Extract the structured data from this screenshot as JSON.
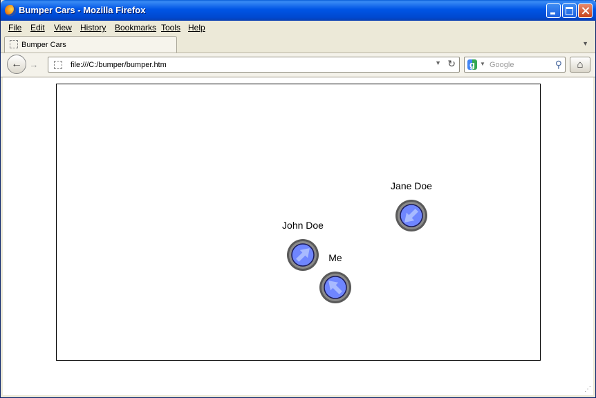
{
  "window": {
    "title": "Bumper Cars - Mozilla Firefox"
  },
  "menu": [
    "File",
    "Edit",
    "View",
    "History",
    "Bookmarks",
    "Tools",
    "Help"
  ],
  "tab": {
    "label": "Bumper Cars"
  },
  "navigation": {
    "url": "file:///C:/bumper/bumper.htm",
    "search_placeholder": "Google"
  },
  "cars": [
    {
      "name": "Jane Doe",
      "direction": "down-left"
    },
    {
      "name": "John Doe",
      "direction": "up-right"
    },
    {
      "name": "Me",
      "direction": "up-left"
    }
  ],
  "colors": {
    "car_body": "#6f86ff",
    "car_ring": "#6a6a6a",
    "car_arrow": "#a8baff"
  }
}
